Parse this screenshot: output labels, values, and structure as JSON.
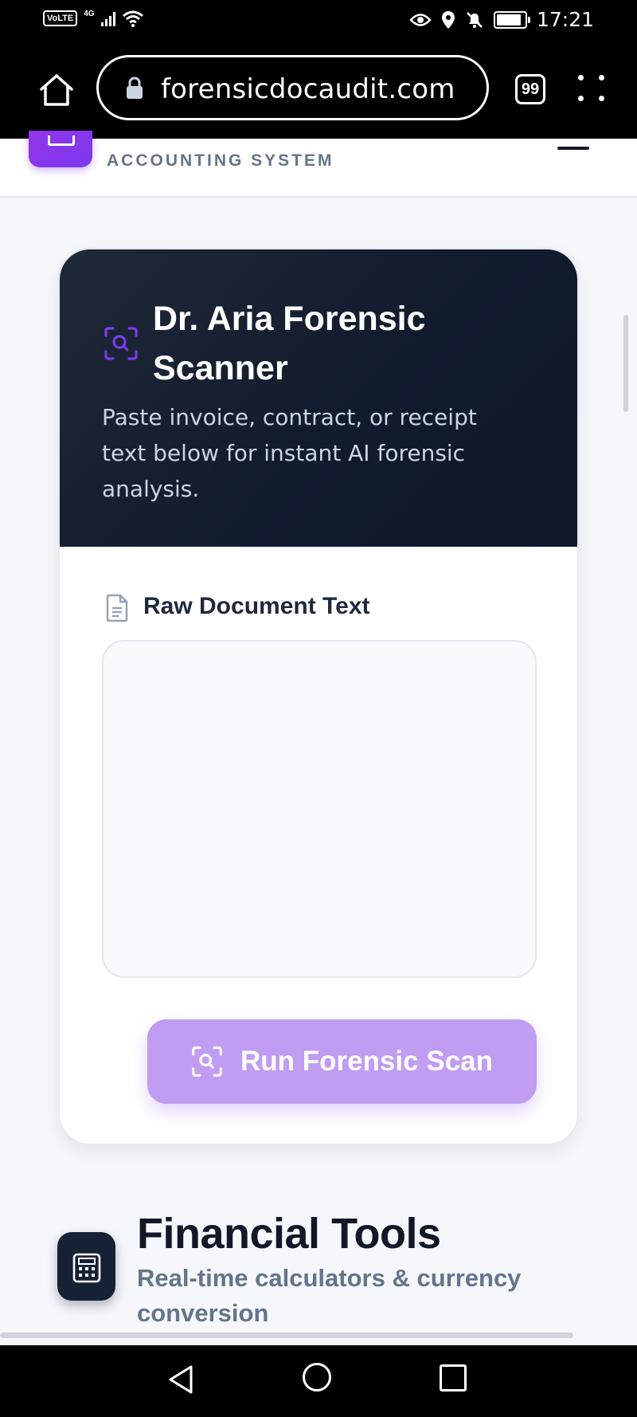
{
  "status_bar": {
    "volte": "VoLTE",
    "network": "4G",
    "time": "17:21",
    "icons": [
      "signal-icon",
      "wifi-icon",
      "eye-icon",
      "location-icon",
      "bell-muted-icon",
      "battery-icon"
    ]
  },
  "browser": {
    "url": "forensicdocaudit.com",
    "tab_count": "99"
  },
  "site_header": {
    "tagline": "ACCOUNTING SYSTEM",
    "brand_color": "#8b3cf0"
  },
  "scanner": {
    "title": "Dr. Aria Forensic Scanner",
    "subtitle": "Paste invoice, contract, or receipt text below for instant AI forensic analysis.",
    "input_label": "Raw Document Text",
    "input_value": "",
    "button_label": "Run Forensic Scan",
    "button_color": "#c09cf3",
    "header_color": "#1a2333"
  },
  "financial_tools": {
    "title": "Financial Tools",
    "subtitle": "Real-time calculators & currency conversion"
  }
}
